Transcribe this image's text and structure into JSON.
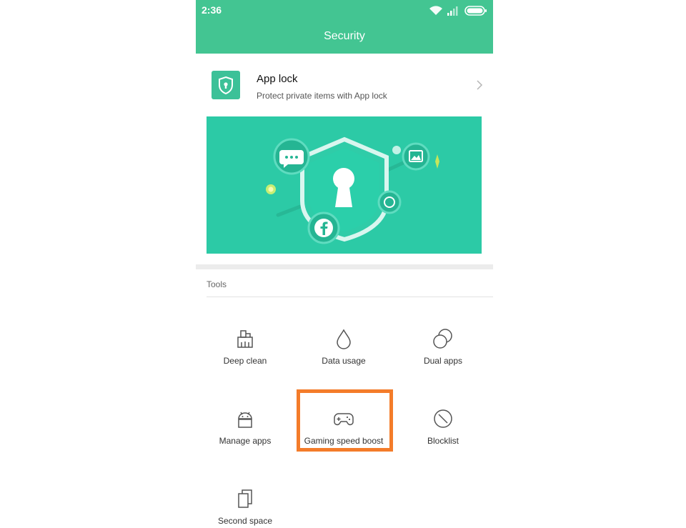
{
  "status_bar": {
    "time": "2:36"
  },
  "header": {
    "title": "Security"
  },
  "app_lock": {
    "title": "App lock",
    "subtitle": "Protect private items with App lock"
  },
  "tools": {
    "section_label": "Tools",
    "items": [
      {
        "label": "Deep clean",
        "icon": "broom-icon"
      },
      {
        "label": "Data usage",
        "icon": "droplet-icon"
      },
      {
        "label": "Dual apps",
        "icon": "dual-circles-icon"
      },
      {
        "label": "Manage apps",
        "icon": "android-icon"
      },
      {
        "label": "Gaming speed boost",
        "icon": "gamepad-icon"
      },
      {
        "label": "Blocklist",
        "icon": "block-icon"
      },
      {
        "label": "Second space",
        "icon": "stacked-pages-icon"
      }
    ]
  },
  "colors": {
    "header": "#43c592",
    "banner": "#2ccaa6",
    "highlight": "#f47c2a"
  }
}
